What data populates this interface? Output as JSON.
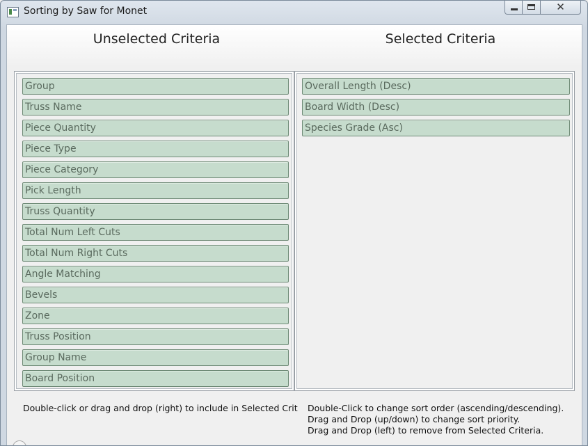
{
  "window": {
    "title": "Sorting by Saw for Monet",
    "icon": "app-window-icon",
    "close_glyph": "✕"
  },
  "unselected": {
    "header": "Unselected Criteria",
    "items": [
      "Group",
      "Truss Name",
      "Piece Quantity",
      "Piece Type",
      "Piece Category",
      "Pick Length",
      "Truss Quantity",
      "Total Num Left Cuts",
      "Total Num Right Cuts",
      "Angle Matching",
      "Bevels",
      "Zone",
      "Truss Position",
      "Group Name",
      "Board Position"
    ],
    "help": "Double-click or drag and drop (right) to include in Selected Crit"
  },
  "selected": {
    "header": "Selected Criteria",
    "items": [
      "Overall Length (Desc)",
      "Board Width (Desc)",
      "Species Grade (Asc)"
    ],
    "help_lines": [
      "Double-Click to change sort order (ascending/descending).",
      "Drag and Drop (up/down) to change sort priority.",
      "Drag and Drop (left) to remove from Selected Criteria."
    ]
  },
  "colors": {
    "item_fill": "#c6dccd",
    "item_border": "#6e8a76",
    "item_text": "#5a6a5e"
  }
}
